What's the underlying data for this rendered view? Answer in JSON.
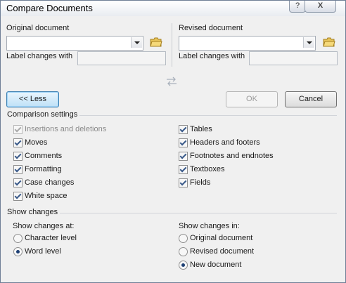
{
  "window": {
    "title": "Compare Documents",
    "help_glyph": "?",
    "close_glyph": "X"
  },
  "original": {
    "heading": "Original document",
    "label_changes": "Label changes with",
    "value": "",
    "label_value": ""
  },
  "revised": {
    "heading": "Revised document",
    "label_changes": "Label changes with",
    "value": "",
    "label_value": ""
  },
  "buttons": {
    "less": "<< Less",
    "ok": "OK",
    "cancel": "Cancel"
  },
  "comparison": {
    "title": "Comparison settings",
    "left": [
      {
        "label": "Insertions and deletions",
        "checked": true,
        "disabled": true
      },
      {
        "label": "Moves",
        "checked": true,
        "disabled": false
      },
      {
        "label": "Comments",
        "checked": true,
        "disabled": false
      },
      {
        "label": "Formatting",
        "checked": true,
        "disabled": false
      },
      {
        "label": "Case changes",
        "checked": true,
        "disabled": false
      },
      {
        "label": "White space",
        "checked": true,
        "disabled": false
      }
    ],
    "right": [
      {
        "label": "Tables",
        "checked": true
      },
      {
        "label": "Headers and footers",
        "checked": true
      },
      {
        "label": "Footnotes and endnotes",
        "checked": true
      },
      {
        "label": "Textboxes",
        "checked": true
      },
      {
        "label": "Fields",
        "checked": true
      }
    ]
  },
  "show": {
    "title": "Show changes",
    "at_title": "Show changes at:",
    "at": [
      {
        "label": "Character level",
        "selected": false
      },
      {
        "label": "Word level",
        "selected": true
      }
    ],
    "in_title": "Show changes in:",
    "in": [
      {
        "label": "Original document",
        "selected": false
      },
      {
        "label": "Revised document",
        "selected": false
      },
      {
        "label": "New document",
        "selected": true
      }
    ]
  },
  "colors": {
    "background": "#f0f0f0",
    "accent": "#3c7fb1"
  }
}
